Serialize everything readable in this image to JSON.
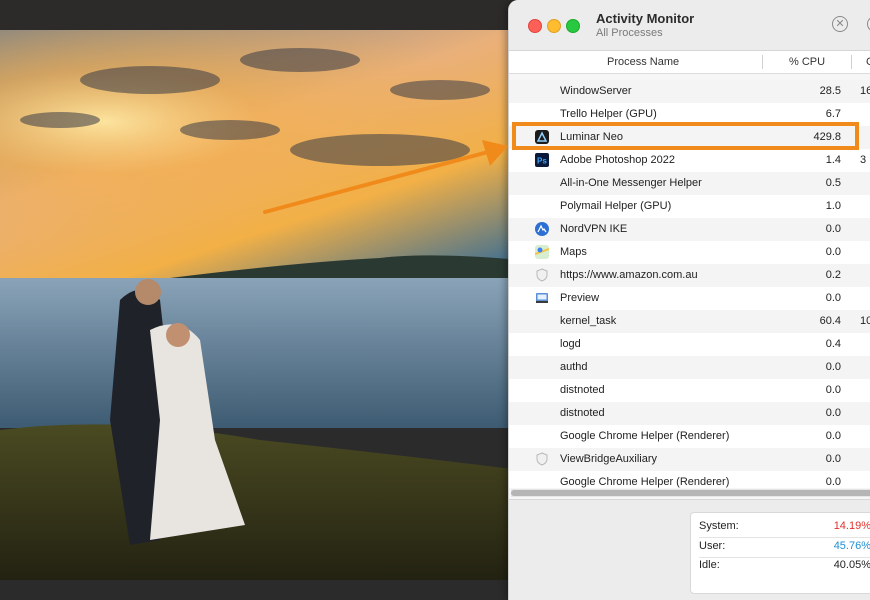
{
  "window": {
    "title": "Activity Monitor",
    "subtitle": "All Processes",
    "toolbar_icon": "close-circle-icon",
    "toolbar_icon_glyph": "✕"
  },
  "columns": {
    "process_name": "Process Name",
    "cpu": "% CPU",
    "partial": "C"
  },
  "processes": [
    {
      "name": "WindowServer",
      "cpu": "28.5",
      "extra": "16",
      "icon": "none"
    },
    {
      "name": "Trello Helper (GPU)",
      "cpu": "6.7",
      "extra": "",
      "icon": "none"
    },
    {
      "name": "Luminar Neo",
      "cpu": "429.8",
      "extra": "",
      "icon": "luminar-neo-icon"
    },
    {
      "name": "Adobe Photoshop 2022",
      "cpu": "1.4",
      "extra": "3",
      "icon": "photoshop-icon"
    },
    {
      "name": "All-in-One Messenger Helper",
      "cpu": "0.5",
      "extra": "",
      "icon": "none"
    },
    {
      "name": "Polymail Helper (GPU)",
      "cpu": "1.0",
      "extra": "",
      "icon": "none"
    },
    {
      "name": "NordVPN IKE",
      "cpu": "0.0",
      "extra": "",
      "icon": "nordvpn-icon"
    },
    {
      "name": "Maps",
      "cpu": "0.0",
      "extra": "",
      "icon": "maps-icon"
    },
    {
      "name": "https://www.amazon.com.au",
      "cpu": "0.2",
      "extra": "",
      "icon": "shield-icon"
    },
    {
      "name": "Preview",
      "cpu": "0.0",
      "extra": "",
      "icon": "preview-icon"
    },
    {
      "name": "kernel_task",
      "cpu": "60.4",
      "extra": "10",
      "icon": "none"
    },
    {
      "name": "logd",
      "cpu": "0.4",
      "extra": "",
      "icon": "none"
    },
    {
      "name": "authd",
      "cpu": "0.0",
      "extra": "",
      "icon": "none"
    },
    {
      "name": "distnoted",
      "cpu": "0.0",
      "extra": "",
      "icon": "none"
    },
    {
      "name": "distnoted",
      "cpu": "0.0",
      "extra": "",
      "icon": "none"
    },
    {
      "name": "Google Chrome Helper (Renderer)",
      "cpu": "0.0",
      "extra": "",
      "icon": "none"
    },
    {
      "name": "ViewBridgeAuxiliary",
      "cpu": "0.0",
      "extra": "",
      "icon": "shield-icon"
    },
    {
      "name": "Google Chrome Helper (Renderer)",
      "cpu": "0.0",
      "extra": "",
      "icon": "none"
    }
  ],
  "stats": {
    "system_label": "System:",
    "system_value": "14.19%",
    "system_color": "#e0322c",
    "user_label": "User:",
    "user_value": "45.76%",
    "user_color": "#1e8fd6",
    "idle_label": "Idle:",
    "idle_value": "40.05%"
  },
  "highlight_color": "#f08a1a",
  "photoshop_icon_text": "Ps"
}
